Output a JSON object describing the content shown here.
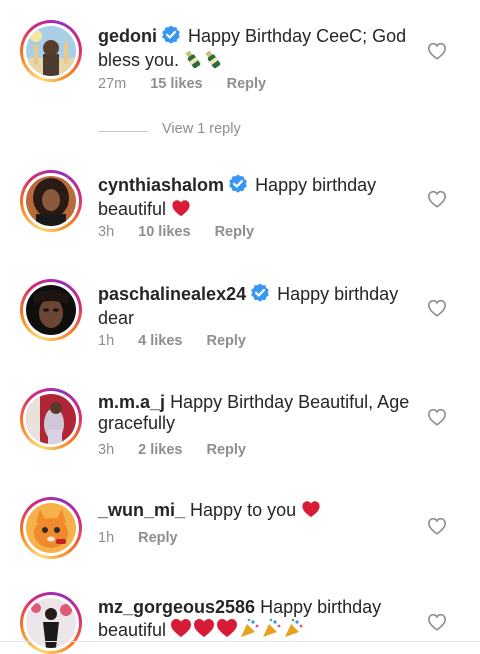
{
  "comments": [
    {
      "username": "gedoni",
      "verified": true,
      "text": "Happy Birthday CeeC; God bless you.",
      "emoji": "bottles",
      "time": "27m",
      "likes": "15 likes",
      "reply": "Reply",
      "view_replies": "View 1 reply"
    },
    {
      "username": "cynthiashalom",
      "verified": true,
      "text": "Happy birthday beautiful",
      "emoji": "red-heart",
      "time": "3h",
      "likes": "10 likes",
      "reply": "Reply"
    },
    {
      "username": "paschalinealex24",
      "verified": true,
      "text": "Happy birthday dear",
      "time": "1h",
      "likes": "4 likes",
      "reply": "Reply"
    },
    {
      "username": "m.m.a_j",
      "verified": false,
      "text": "Happy Birthday Beautiful, Age gracefully",
      "time": "3h",
      "likes": "2 likes",
      "reply": "Reply"
    },
    {
      "username": "_wun_mi_",
      "verified": false,
      "text": "Happy to you",
      "emoji": "red-heart",
      "time": "1h",
      "reply": "Reply"
    },
    {
      "username": "mz_gorgeous2586",
      "verified": false,
      "text": "Happy birthday beautiful",
      "emoji": "hearts-and-party-poppers"
    }
  ],
  "colors": {
    "username": "#262626",
    "meta": "#8e8e8e",
    "verified": "#3897f0",
    "heart": "#e0245e"
  }
}
